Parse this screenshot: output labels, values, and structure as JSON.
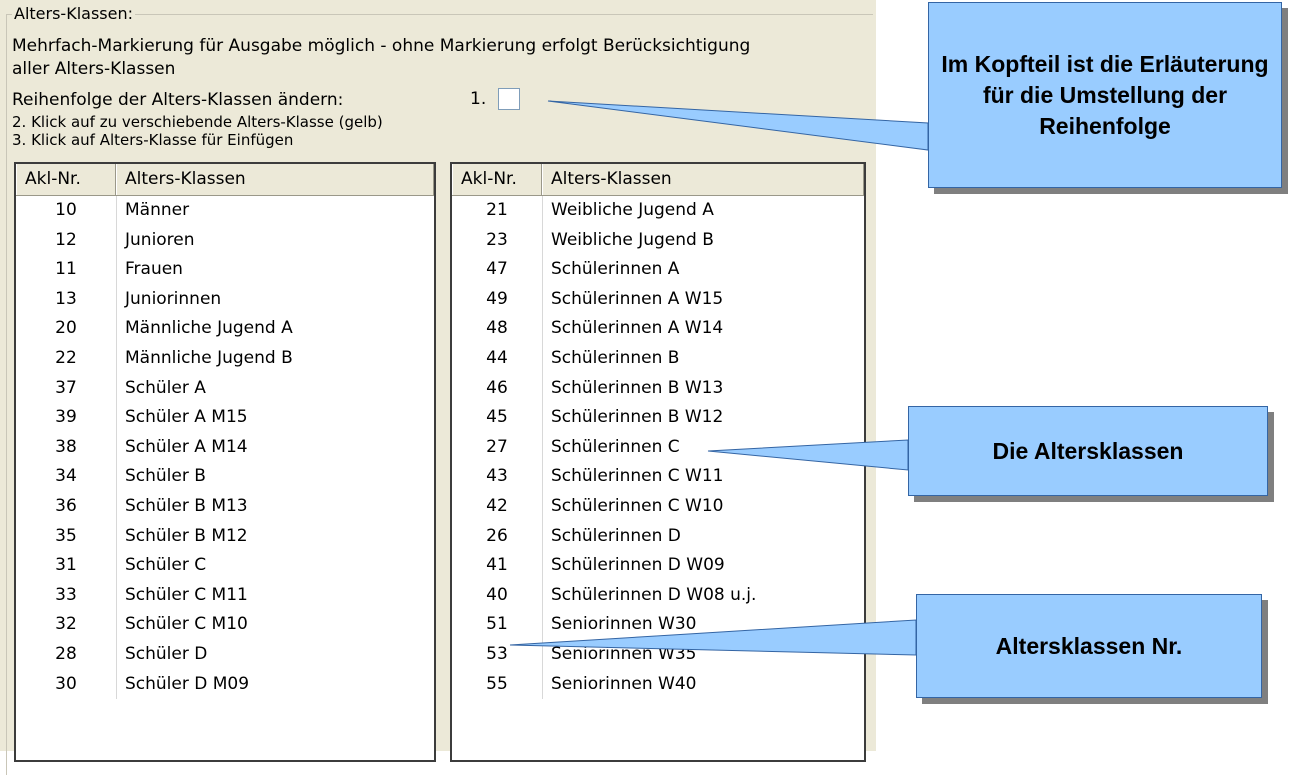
{
  "group": {
    "legend": "Alters-Klassen:",
    "hint_line1": "Mehrfach-Markierung für Ausgabe möglich - ohne Markierung erfolgt Berücksichtigung",
    "hint_line2": "aller Alters-Klassen",
    "reorder_label": "Reihenfolge der Alters-Klassen ändern:",
    "step1": "1.",
    "step2": " 2. Klick auf zu verschiebende Alters-Klasse (gelb)",
    "step3": " 3. Klick auf Alters-Klasse für Einfügen"
  },
  "left_list": {
    "headers": [
      "Akl-Nr.",
      "Alters-Klassen"
    ],
    "rows": [
      [
        "10",
        "Männer"
      ],
      [
        "12",
        "Junioren"
      ],
      [
        "11",
        "Frauen"
      ],
      [
        "13",
        "Juniorinnen"
      ],
      [
        "20",
        "Männliche Jugend A"
      ],
      [
        "22",
        "Männliche Jugend B"
      ],
      [
        "37",
        "Schüler A"
      ],
      [
        "39",
        "Schüler A  M15"
      ],
      [
        "38",
        "Schüler A  M14"
      ],
      [
        "34",
        "Schüler B"
      ],
      [
        "36",
        "Schüler B  M13"
      ],
      [
        "35",
        "Schüler B  M12"
      ],
      [
        "31",
        "Schüler C"
      ],
      [
        "33",
        "Schüler C  M11"
      ],
      [
        "32",
        "Schüler C  M10"
      ],
      [
        "28",
        "Schüler D"
      ],
      [
        "30",
        "Schüler D  M09"
      ]
    ]
  },
  "right_list": {
    "headers": [
      "Akl-Nr.",
      "Alters-Klassen"
    ],
    "rows": [
      [
        "21",
        "Weibliche Jugend A"
      ],
      [
        "23",
        "Weibliche Jugend B"
      ],
      [
        "47",
        "Schülerinnen A"
      ],
      [
        "49",
        "Schülerinnen A  W15"
      ],
      [
        "48",
        "Schülerinnen A  W14"
      ],
      [
        "44",
        "Schülerinnen B"
      ],
      [
        "46",
        "Schülerinnen B  W13"
      ],
      [
        "45",
        "Schülerinnen B  W12"
      ],
      [
        "27",
        "Schülerinnen C"
      ],
      [
        "43",
        "Schülerinnen C  W11"
      ],
      [
        "42",
        "Schülerinnen C  W10"
      ],
      [
        "26",
        "Schülerinnen D"
      ],
      [
        "41",
        "Schülerinnen D  W09"
      ],
      [
        "40",
        "Schülerinnen D  W08 u.j."
      ],
      [
        "51",
        "Seniorinnen W30"
      ],
      [
        "53",
        "Seniorinnen W35"
      ],
      [
        "55",
        "Seniorinnen W40"
      ]
    ]
  },
  "callouts": {
    "header_note": "Im Kopfteil ist die Erläuterung für die Umstellung der Reihenfolge",
    "classes_note": "Die Altersklassen",
    "number_note": "Altersklassen Nr."
  },
  "colors": {
    "panel": "#ece9d8",
    "callout_fill": "#99ccff",
    "callout_border": "#3465a4"
  }
}
